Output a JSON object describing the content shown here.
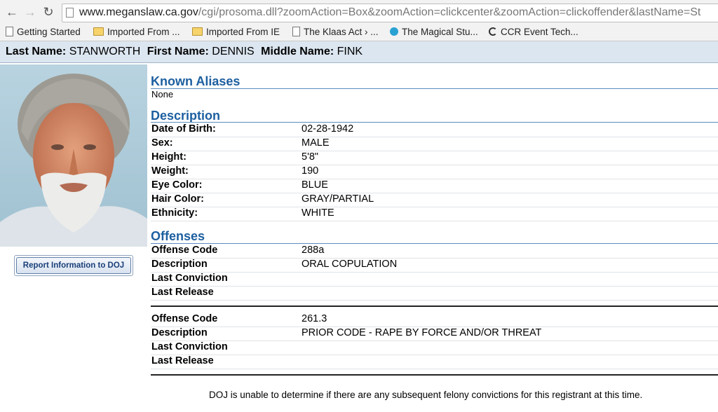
{
  "browser": {
    "url_host": "www.meganslaw.ca.gov",
    "url_path": "/cgi/prosoma.dll?zoomAction=Box&zoomAction=clickcenter&zoomAction=clickoffender&lastName=St",
    "bookmarks": [
      {
        "label": "Getting Started",
        "icon": "page-icon"
      },
      {
        "label": "Imported From ...",
        "icon": "folder-icon"
      },
      {
        "label": "Imported From IE",
        "icon": "folder-icon"
      },
      {
        "label": "The Klaas Act › ...",
        "icon": "page-icon"
      },
      {
        "label": "The Magical Stu...",
        "icon": "globe-icon"
      },
      {
        "label": "CCR Event Tech...",
        "icon": "ccr-icon"
      }
    ]
  },
  "header": {
    "last_name_label": "Last Name:",
    "last_name": "STANWORTH",
    "first_name_label": "First Name:",
    "first_name": "DENNIS",
    "middle_name_label": "Middle Name:",
    "middle_name": "FINK"
  },
  "sidebar": {
    "report_button": "Report Information to DOJ"
  },
  "aliases": {
    "title": "Known Aliases",
    "value": "None"
  },
  "description": {
    "title": "Description",
    "rows": [
      {
        "label": "Date of Birth:",
        "value": "02-28-1942"
      },
      {
        "label": "Sex:",
        "value": "MALE"
      },
      {
        "label": "Height:",
        "value": "5'8\""
      },
      {
        "label": "Weight:",
        "value": "190"
      },
      {
        "label": "Eye Color:",
        "value": "BLUE"
      },
      {
        "label": "Hair Color:",
        "value": "GRAY/PARTIAL"
      },
      {
        "label": "Ethnicity:",
        "value": "WHITE"
      }
    ]
  },
  "offenses": {
    "title": "Offenses",
    "groups": [
      {
        "rows": [
          {
            "label": "Offense Code",
            "value": "288a"
          },
          {
            "label": "Description",
            "value": "ORAL COPULATION"
          },
          {
            "label": "Last Conviction",
            "value": ""
          },
          {
            "label": "Last Release",
            "value": ""
          }
        ]
      },
      {
        "rows": [
          {
            "label": "Offense Code",
            "value": "261.3"
          },
          {
            "label": "Description",
            "value": "PRIOR CODE - RAPE BY FORCE AND/OR THREAT"
          },
          {
            "label": "Last Conviction",
            "value": ""
          },
          {
            "label": "Last Release",
            "value": ""
          }
        ]
      }
    ]
  },
  "footer_note": "DOJ is unable to determine if there are any subsequent felony convictions for this registrant at this time.",
  "colors": {
    "section_title": "#1d5fa0",
    "name_bar": "#dce6f0"
  }
}
